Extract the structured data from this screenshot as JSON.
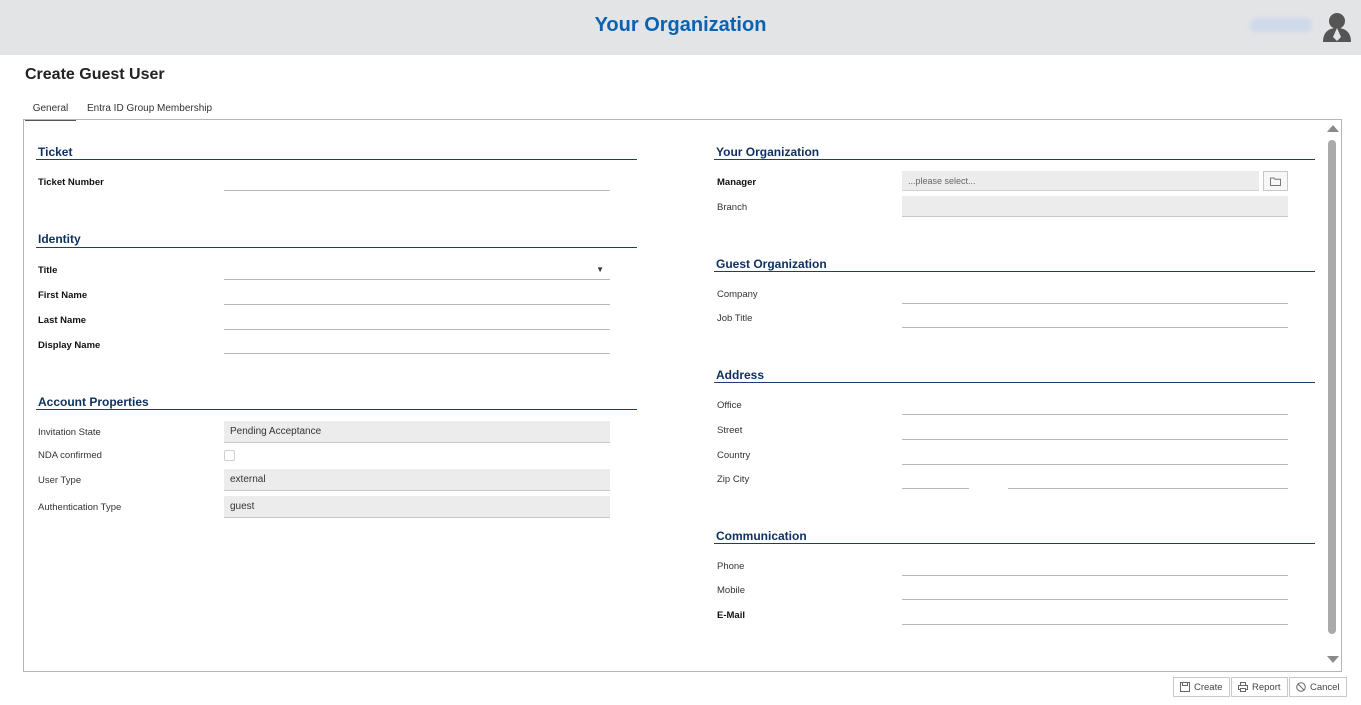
{
  "header": {
    "brand": "Your Organization",
    "user_name": "████████"
  },
  "page": {
    "title": "Create Guest User"
  },
  "tabs": [
    {
      "label": "General",
      "active": true
    },
    {
      "label": "Entra ID Group Membership",
      "active": false
    }
  ],
  "left": {
    "ticket": {
      "title": "Ticket",
      "ticket_number_label": "Ticket Number",
      "ticket_number_value": ""
    },
    "identity": {
      "title": "Identity",
      "title_label": "Title",
      "title_value": "",
      "first_name_label": "First Name",
      "first_name_value": "",
      "last_name_label": "Last Name",
      "last_name_value": "",
      "display_name_label": "Display Name",
      "display_name_value": ""
    },
    "account": {
      "title": "Account Properties",
      "invitation_state_label": "Invitation State",
      "invitation_state_value": "Pending Acceptance",
      "nda_label": "NDA confirmed",
      "nda_checked": false,
      "user_type_label": "User Type",
      "user_type_value": "external",
      "auth_type_label": "Authentication Type",
      "auth_type_value": "guest"
    }
  },
  "right": {
    "organization": {
      "title": "Your Organization",
      "manager_label": "Manager",
      "manager_placeholder": "...please select...",
      "branch_label": "Branch",
      "branch_value": ""
    },
    "guest_org": {
      "title": "Guest Organization",
      "company_label": "Company",
      "job_title_label": "Job Title"
    },
    "address": {
      "title": "Address",
      "office_label": "Office",
      "street_label": "Street",
      "country_label": "Country",
      "zip_city_label": "Zip City"
    },
    "communication": {
      "title": "Communication",
      "phone_label": "Phone",
      "mobile_label": "Mobile",
      "email_label": "E-Mail"
    }
  },
  "footer": {
    "create_label": "Create",
    "report_label": "Report",
    "cancel_label": "Cancel"
  },
  "colors": {
    "brand": "#0b62b0",
    "section_title": "#0f3160",
    "topbar_bg": "#e3e4e6"
  }
}
